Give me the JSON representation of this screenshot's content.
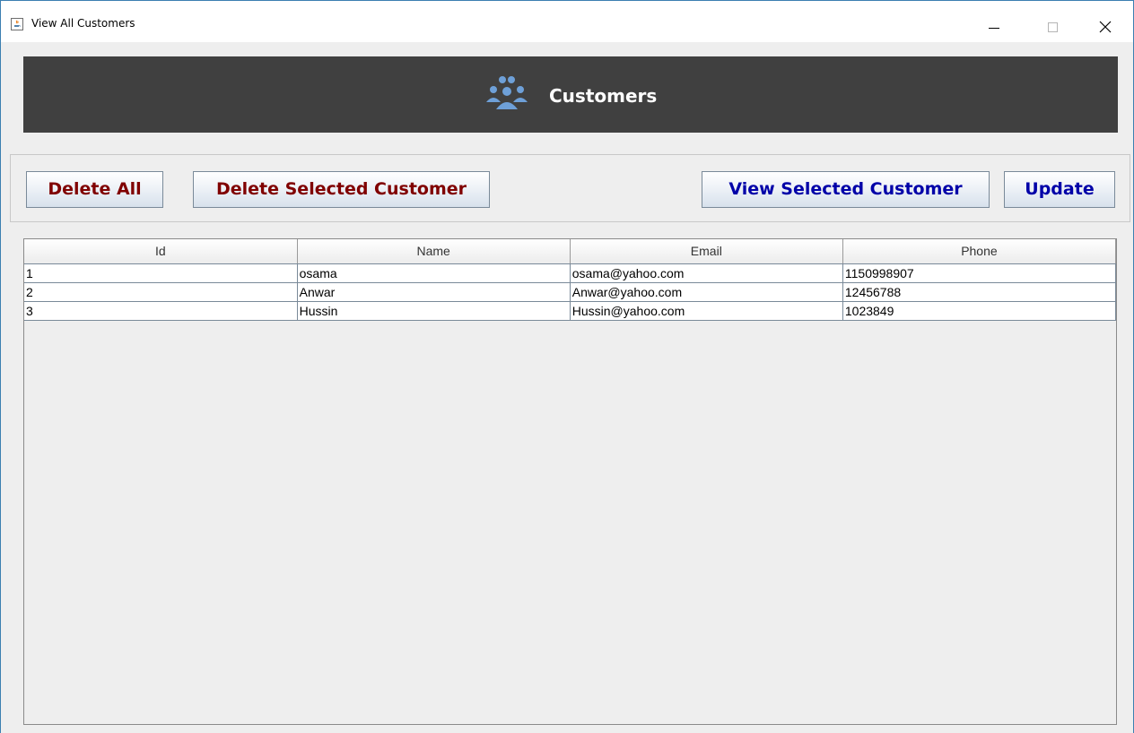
{
  "window": {
    "title": "View All Customers",
    "icon": "java-cup-icon",
    "controls": {
      "minimize_icon": "minimize-icon",
      "maximize_icon": "maximize-icon",
      "close_icon": "close-icon"
    }
  },
  "header": {
    "title": "Customers",
    "icon": "people-group-icon",
    "background_color": "#404040",
    "icon_color": "#6ea0d8"
  },
  "toolbar": {
    "delete_all_label": "Delete All",
    "delete_selected_label": "Delete Selected Customer",
    "view_selected_label": "View Selected Customer",
    "update_label": "Update",
    "delete_color": "#800000",
    "view_update_color": "#0000a8"
  },
  "table": {
    "columns": [
      "Id",
      "Name",
      "Email",
      "Phone"
    ],
    "rows": [
      [
        "1",
        "osama",
        "osama@yahoo.com",
        "1150998907"
      ],
      [
        "2",
        "Anwar",
        "Anwar@yahoo.com",
        "12456788"
      ],
      [
        "3",
        "Hussin",
        "Hussin@yahoo.com",
        "1023849"
      ]
    ]
  }
}
